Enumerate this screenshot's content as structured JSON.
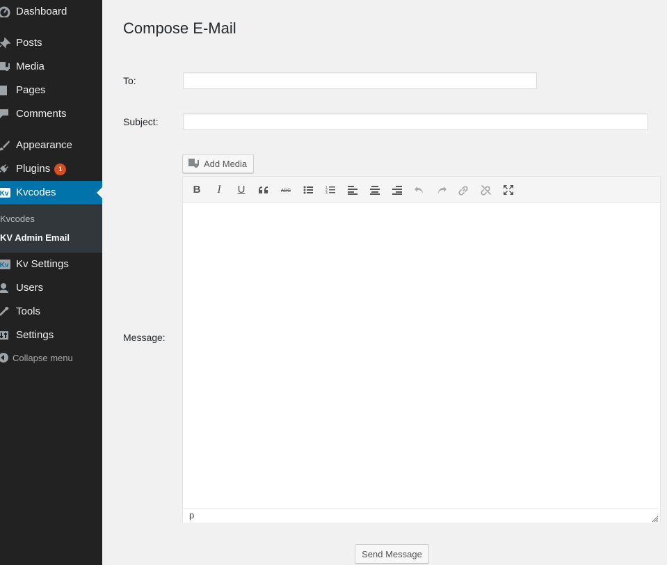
{
  "sidebar": {
    "items": [
      {
        "key": "dashboard",
        "label": "Dashboard",
        "icon": "dashboard-icon"
      },
      {
        "key": "posts",
        "label": "Posts",
        "icon": "pin-icon"
      },
      {
        "key": "media",
        "label": "Media",
        "icon": "media-icon"
      },
      {
        "key": "pages",
        "label": "Pages",
        "icon": "pages-icon"
      },
      {
        "key": "comments",
        "label": "Comments",
        "icon": "comment-icon"
      },
      {
        "key": "appearance",
        "label": "Appearance",
        "icon": "brush-icon"
      },
      {
        "key": "plugins",
        "label": "Plugins",
        "icon": "plug-icon",
        "badge": "1"
      },
      {
        "key": "kvcodes",
        "label": "Kvcodes",
        "icon": "kv-logo-icon",
        "active": true
      },
      {
        "key": "kv-settings",
        "label": "Kv Settings",
        "icon": "kv-logo-icon"
      },
      {
        "key": "users",
        "label": "Users",
        "icon": "user-icon"
      },
      {
        "key": "tools",
        "label": "Tools",
        "icon": "wrench-icon"
      },
      {
        "key": "settings",
        "label": "Settings",
        "icon": "sliders-icon"
      }
    ],
    "submenu": [
      {
        "label": "Kvcodes",
        "current": false
      },
      {
        "label": "KV Admin Email",
        "current": true
      }
    ],
    "collapse_label": "Collapse menu"
  },
  "main": {
    "title": "Compose E-Mail",
    "to_label": "To:",
    "to_value": "",
    "subject_label": "Subject:",
    "subject_value": "",
    "message_label": "Message:",
    "add_media_label": "Add Media",
    "editor": {
      "toolbar": [
        "bold",
        "italic",
        "underline",
        "blockquote",
        "strikethrough",
        "bullet-list",
        "numbered-list",
        "align-left",
        "align-center",
        "align-right",
        "undo",
        "redo",
        "link",
        "unlink",
        "fullscreen"
      ],
      "status_path": "p",
      "content": ""
    },
    "send_label": "Send Message"
  },
  "colors": {
    "sidebar_bg": "#222222",
    "active_bg": "#0073aa",
    "submenu_bg": "#32373c",
    "badge": "#d54e21",
    "page_bg": "#f1f1f1"
  }
}
